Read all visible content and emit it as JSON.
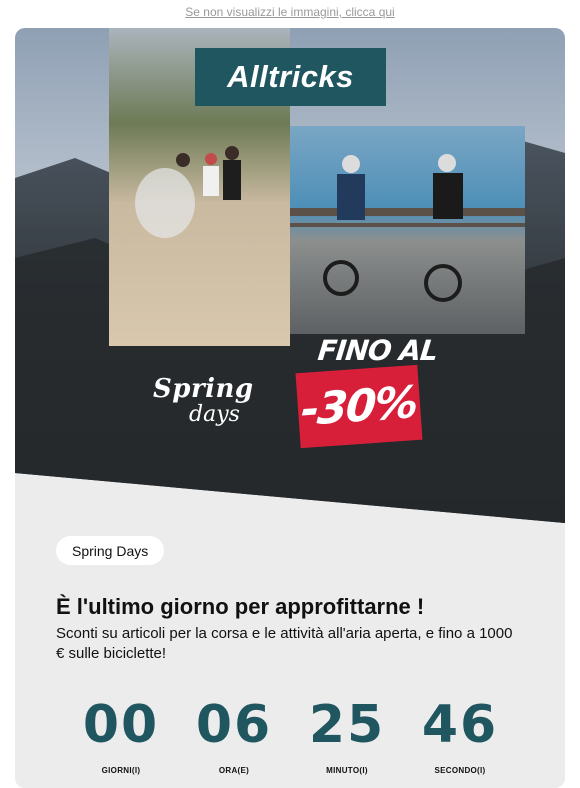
{
  "preheader": {
    "link_text": "Se non visualizzi le immagini, clicca qui"
  },
  "hero": {
    "brand": "Alltricks",
    "campaign_logo": {
      "line1": "Spring",
      "line2": "days"
    },
    "offer": {
      "prefix": "FINO AL",
      "discount": "-30%"
    },
    "colors": {
      "brand": "#1f5660",
      "discount_badge": "#d81f3a"
    }
  },
  "content": {
    "tag": "Spring Days",
    "headline": "È l'ultimo giorno per approfittarne !",
    "body": "Sconti su articoli per la corsa e le attività all'aria aperta, e fino a 1000 € sulle biciclette!"
  },
  "countdown": {
    "units": [
      {
        "value": "00",
        "label": "GIORNI(I)"
      },
      {
        "value": "06",
        "label": "ORA(E)"
      },
      {
        "value": "25",
        "label": "MINUTO(I)"
      },
      {
        "value": "46",
        "label": "SECONDO(I)"
      }
    ],
    "color": "#1f5660"
  }
}
